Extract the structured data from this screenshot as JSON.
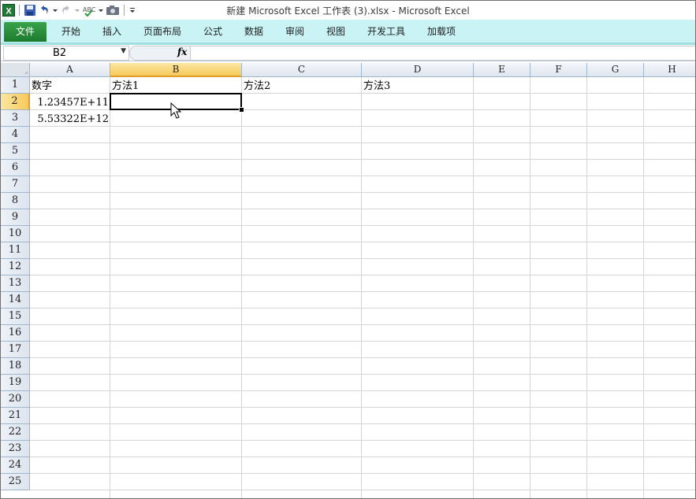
{
  "window": {
    "title": "新建 Microsoft Excel 工作表 (3).xlsx  -  Microsoft Excel"
  },
  "quick_access": {
    "icons": [
      "excel-icon",
      "save-icon",
      "undo-icon",
      "redo-icon",
      "spelling-icon",
      "camera-icon",
      "customize-icon"
    ]
  },
  "ribbon": {
    "tabs": [
      "文件",
      "开始",
      "插入",
      "页面布局",
      "公式",
      "数据",
      "审阅",
      "视图",
      "开发工具",
      "加载项"
    ],
    "accent": "#2a8f3c",
    "tab_bg": "#c9f3f5"
  },
  "formula_bar": {
    "name_box": "B2",
    "fx_label": "fx",
    "formula": ""
  },
  "sheet": {
    "columns": [
      "A",
      "B",
      "C",
      "D",
      "E",
      "F",
      "G",
      "H"
    ],
    "selected_column": "B",
    "rows": [
      "1",
      "2",
      "3",
      "4",
      "5",
      "6",
      "7",
      "8",
      "9",
      "10",
      "11",
      "12",
      "13",
      "14",
      "15",
      "16",
      "17",
      "18",
      "19",
      "20",
      "21",
      "22",
      "23",
      "24",
      "25"
    ],
    "selected_row": "2",
    "cells": {
      "A1": "数字",
      "B1": "方法1",
      "C1": "方法2",
      "D1": "方法3",
      "A2": "1.23457E+11",
      "A3": "5.53322E+12"
    },
    "active_cell": "B2"
  }
}
